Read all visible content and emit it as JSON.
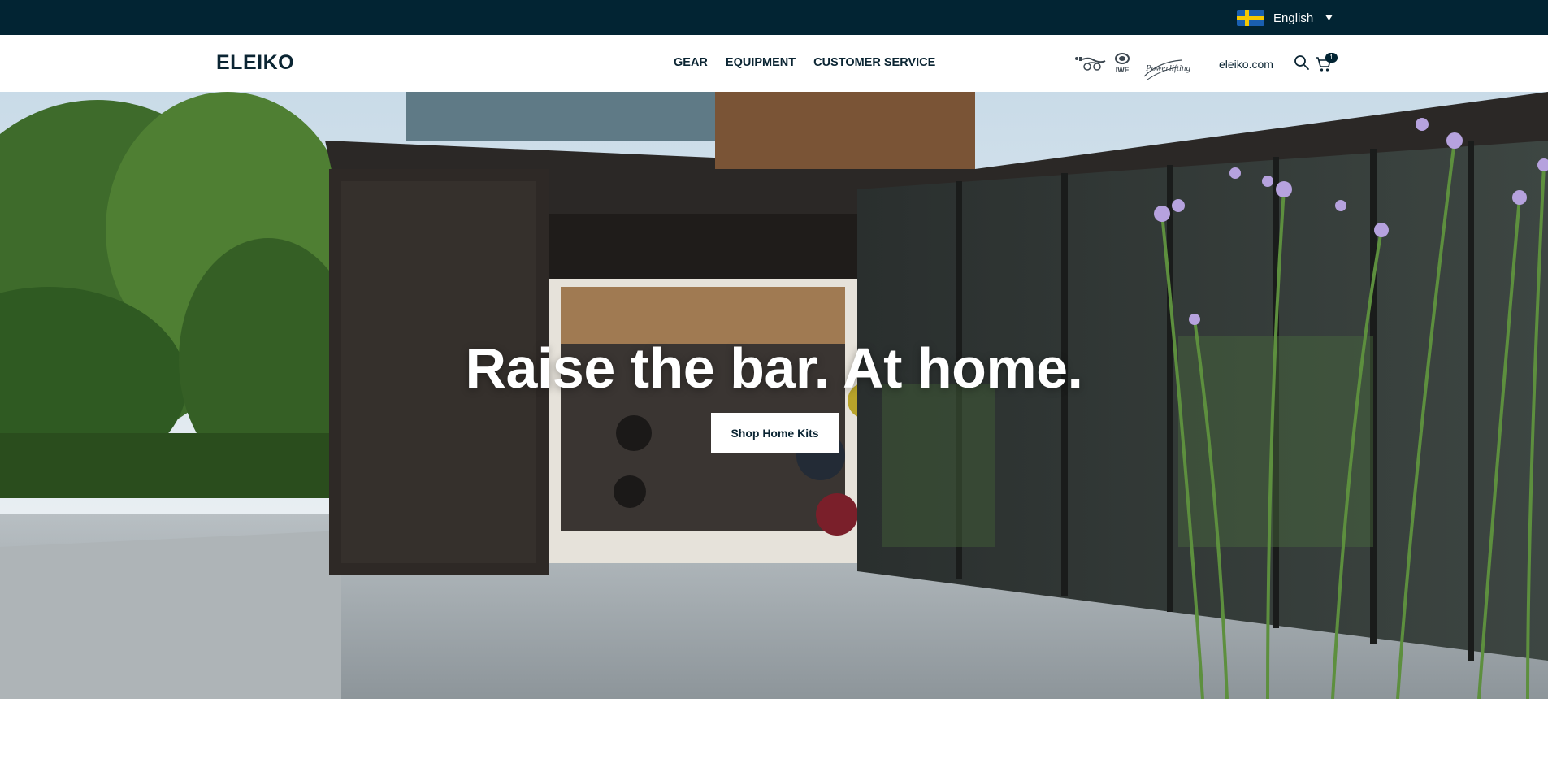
{
  "topbar": {
    "language": {
      "label": "English",
      "flag": "sweden-flag-icon"
    }
  },
  "header": {
    "logo": "ELEIKO",
    "nav": [
      {
        "label": "GEAR"
      },
      {
        "label": "EQUIPMENT"
      },
      {
        "label": "CUSTOMER SERVICE"
      }
    ],
    "partners": {
      "iwf": "IWF",
      "world_para_powerlifting": "Powerlifting"
    },
    "site_link": "eleiko.com",
    "cart_count": "1"
  },
  "hero": {
    "title": "Raise the bar. At home.",
    "cta_label": "Shop Home Kits"
  },
  "colors": {
    "topbar_bg": "#022433",
    "brand_text": "#0b2533",
    "button_bg": "#ffffff"
  }
}
